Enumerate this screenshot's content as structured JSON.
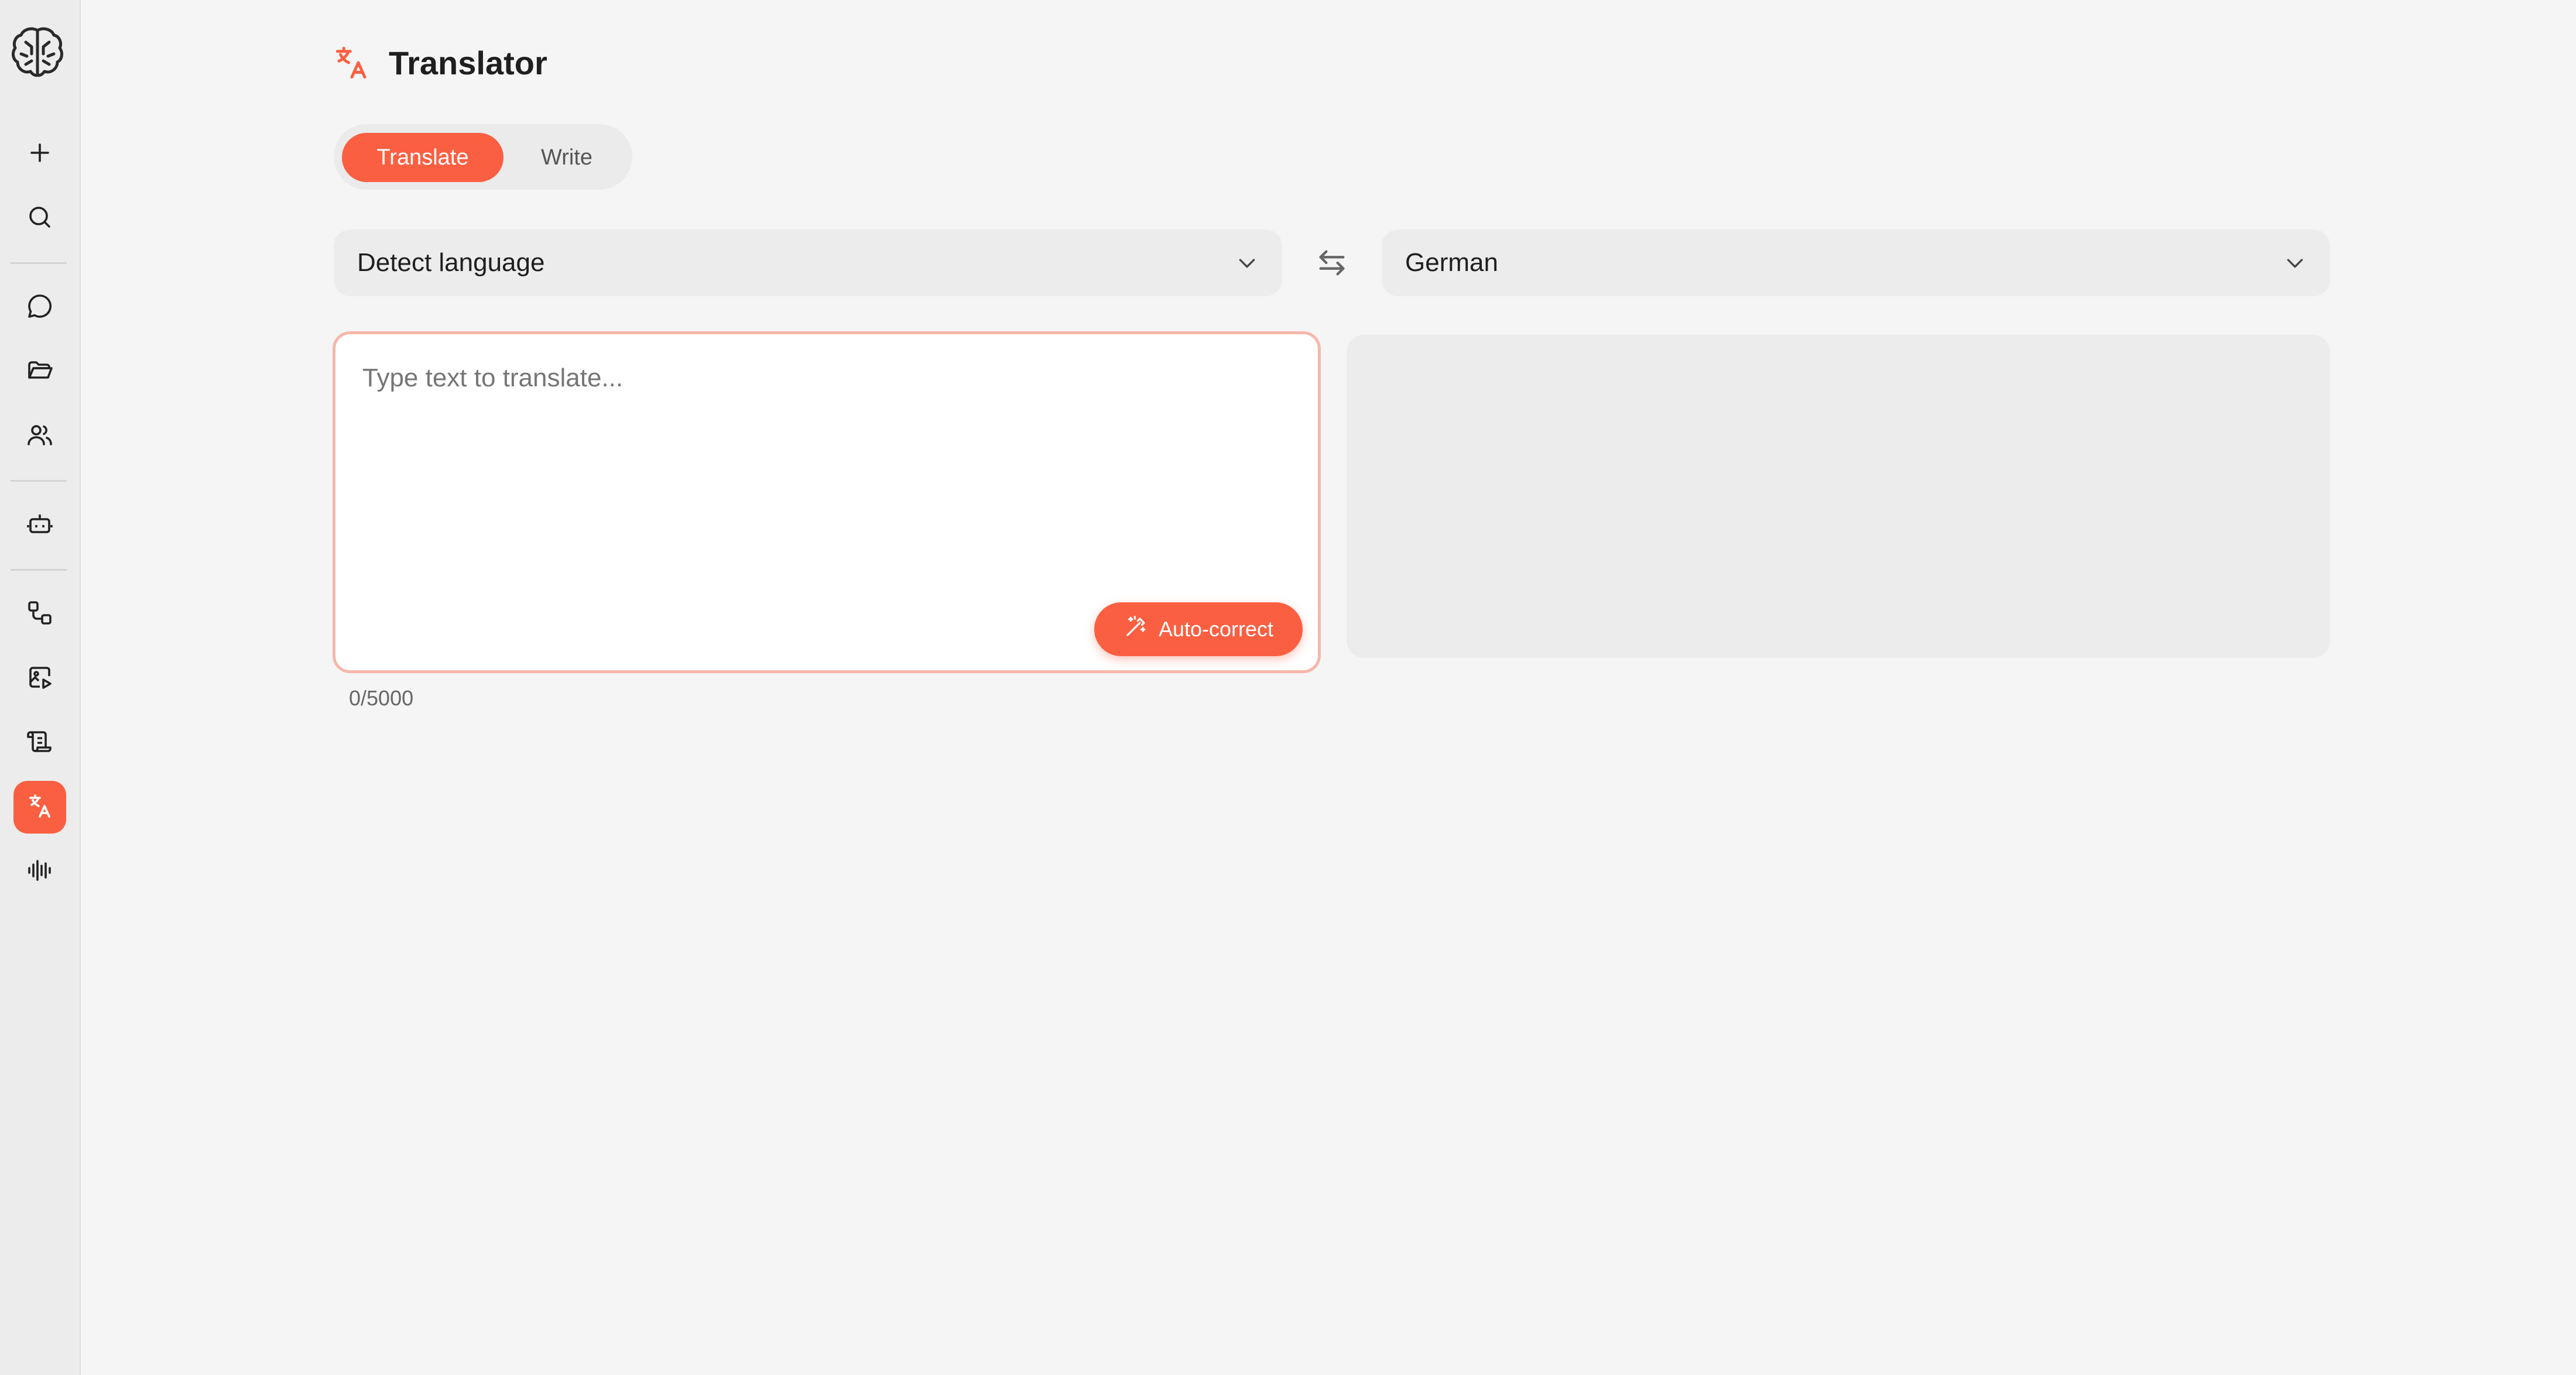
{
  "page": {
    "title": "Translator"
  },
  "tabs": [
    {
      "label": "Translate",
      "active": true
    },
    {
      "label": "Write",
      "active": false
    }
  ],
  "source_language": {
    "selected": "Detect language"
  },
  "target_language": {
    "selected": "German"
  },
  "input": {
    "placeholder": "Type text to translate...",
    "value": "",
    "counter": "0/5000"
  },
  "autocorrect": {
    "label": "Auto-correct"
  },
  "sidebar": {
    "items": [
      {
        "icon": "plus-icon"
      },
      {
        "icon": "search-icon"
      },
      {
        "icon": "chat-icon"
      },
      {
        "icon": "folder-icon"
      },
      {
        "icon": "users-icon"
      },
      {
        "icon": "bot-icon"
      },
      {
        "icon": "workflow-icon"
      },
      {
        "icon": "image-video-icon"
      },
      {
        "icon": "scroll-icon"
      },
      {
        "icon": "translate-icon",
        "active": true
      },
      {
        "icon": "audio-wave-icon"
      }
    ]
  },
  "colors": {
    "accent": "#fb5f42",
    "input_border": "#f7b7aa",
    "background": "#f5f5f5",
    "sidebar": "#ececec"
  }
}
